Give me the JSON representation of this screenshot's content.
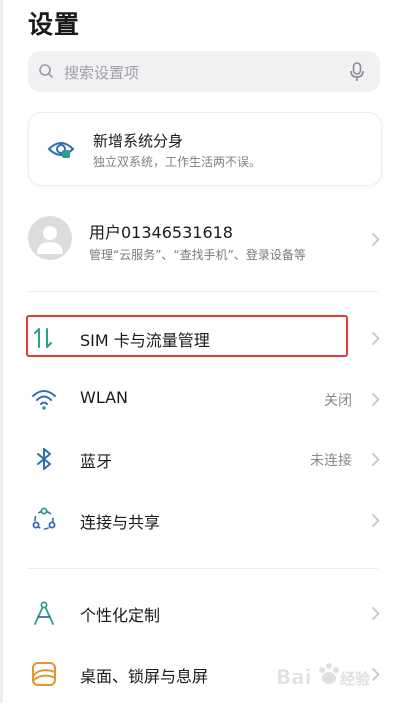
{
  "header": {
    "title": "设置"
  },
  "search": {
    "placeholder": "搜索设置项"
  },
  "promo_card": {
    "title": "新增系统分身",
    "subtitle": "独立双系统，工作生活两不误。"
  },
  "account": {
    "name": "用户01346531618",
    "description": "管理“云服务”、“查找手机”、登录设备等"
  },
  "settings": [
    {
      "label": "SIM 卡与流量管理",
      "icon": "sim-traffic-icon",
      "status": ""
    },
    {
      "label": "WLAN",
      "icon": "wifi-icon",
      "status": "关闭"
    },
    {
      "label": "蓝牙",
      "icon": "bluetooth-icon",
      "status": "未连接"
    },
    {
      "label": "连接与共享",
      "icon": "share-connection-icon",
      "status": ""
    },
    {
      "label": "个性化定制",
      "icon": "personalize-icon",
      "status": ""
    },
    {
      "label": "桌面、锁屏与息屏",
      "icon": "desktop-icon",
      "status": ""
    }
  ],
  "colors": {
    "accent": "#2c9f8e",
    "highlight": "#e53a3a",
    "desktop_icon": "#e8912d"
  }
}
